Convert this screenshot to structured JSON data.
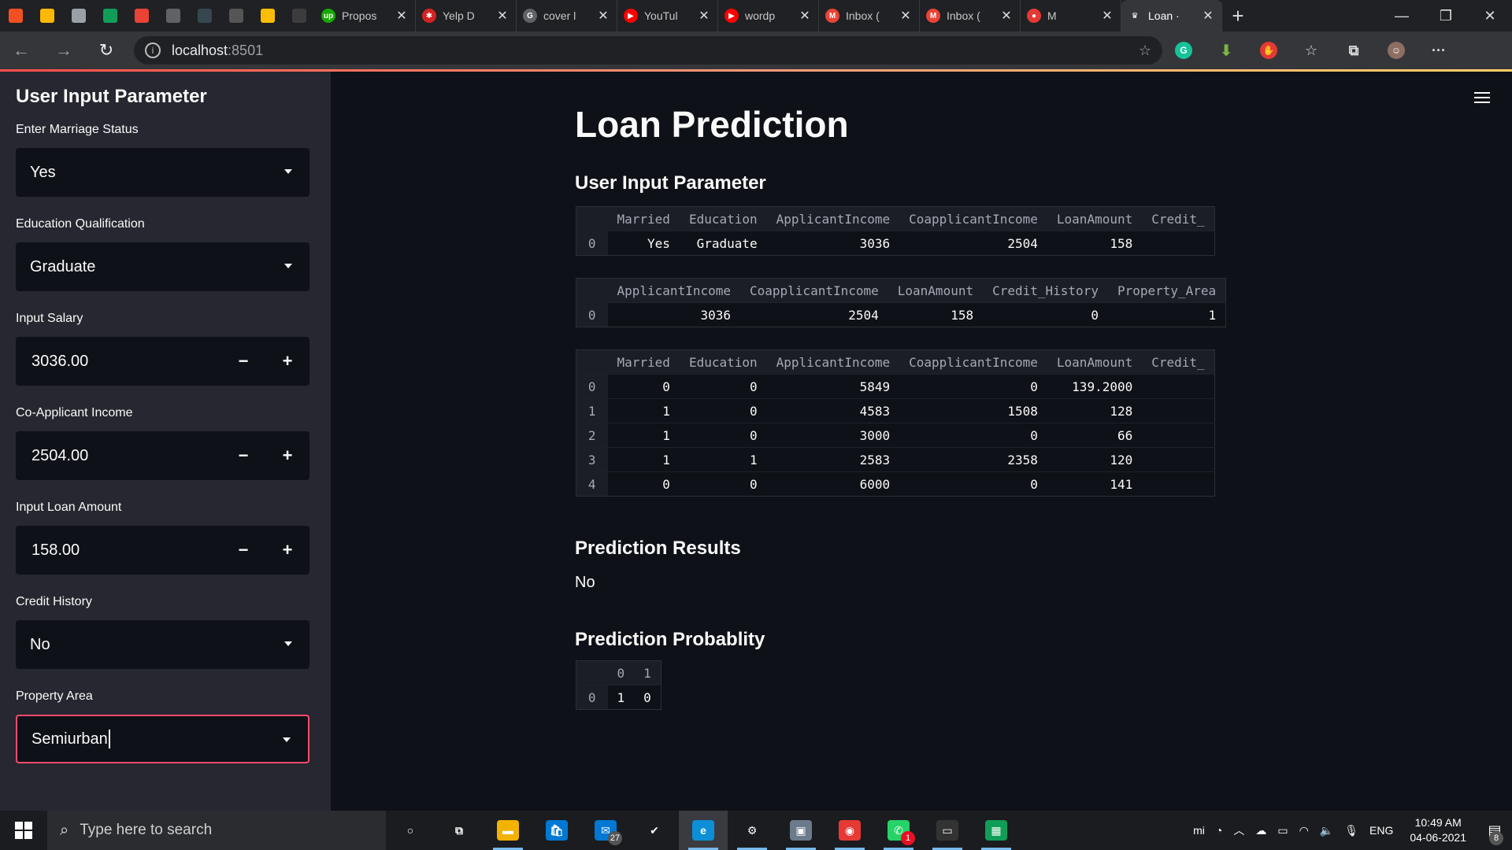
{
  "browser": {
    "pinned_tabs": [
      {
        "icon": "windows-apps-icon",
        "color": "#f25022"
      },
      {
        "icon": "office-grid-icon",
        "color": "#ffb900"
      },
      {
        "icon": "document-icon",
        "color": "#9aa0a6"
      },
      {
        "icon": "sheets-icon",
        "color": "#0f9d58"
      },
      {
        "icon": "gmail-icon",
        "color": "#ea4335"
      },
      {
        "icon": "cc-icon",
        "color": "#5f6368"
      },
      {
        "icon": "tds-icon",
        "color": "#37474f"
      },
      {
        "icon": "w3-icon",
        "color": "#555555"
      },
      {
        "icon": "drive-icon",
        "color": "#fbbc04"
      },
      {
        "icon": "d-icon",
        "color": "#3c3c3c"
      }
    ],
    "tabs": [
      {
        "label": "Propos",
        "fav_color": "#14a800",
        "fav_text": "up"
      },
      {
        "label": "Yelp D",
        "fav_color": "#d32323",
        "fav_text": "✱"
      },
      {
        "label": "cover l",
        "fav_color": "#5f6368",
        "fav_text": "G"
      },
      {
        "label": "YouTul",
        "fav_color": "#ff0000",
        "fav_text": "▶"
      },
      {
        "label": "wordp",
        "fav_color": "#ff0000",
        "fav_text": "▶"
      },
      {
        "label": "Inbox (",
        "fav_color": "#ea4335",
        "fav_text": "M"
      },
      {
        "label": "Inbox (",
        "fav_color": "#ea4335",
        "fav_text": "M"
      },
      {
        "label": "M",
        "fav_color": "#e53935",
        "fav_text": "●"
      },
      {
        "label": "Loan ·",
        "fav_color": "#35363a",
        "fav_text": "♛"
      }
    ],
    "url_host": "localhost",
    "url_port": ":8501"
  },
  "sidebar": {
    "title": "User Input Parameter",
    "marriage": {
      "label": "Enter Marriage Status",
      "value": "Yes"
    },
    "education": {
      "label": "Education Qualification",
      "value": "Graduate"
    },
    "salary": {
      "label": "Input Salary",
      "value": "3036.00"
    },
    "coapplicant": {
      "label": "Co-Applicant Income",
      "value": "2504.00"
    },
    "loan": {
      "label": "Input Loan Amount",
      "value": "158.00"
    },
    "credit": {
      "label": "Credit History",
      "value": "No"
    },
    "property": {
      "label": "Property Area",
      "value": "Semiurban"
    },
    "minus": "−",
    "plus": "+"
  },
  "main": {
    "title": "Loan Prediction",
    "input_header": "User Input Parameter",
    "table1": {
      "columns": [
        "Married",
        "Education",
        "ApplicantIncome",
        "CoapplicantIncome",
        "LoanAmount",
        "Credit_"
      ],
      "rows": [
        {
          "idx": "0",
          "cells": [
            "Yes",
            "Graduate",
            "3036",
            "2504",
            "158",
            ""
          ]
        }
      ]
    },
    "table2": {
      "columns": [
        "ApplicantIncome",
        "CoapplicantIncome",
        "LoanAmount",
        "Credit_History",
        "Property_Area"
      ],
      "rows": [
        {
          "idx": "0",
          "cells": [
            "3036",
            "2504",
            "158",
            "0",
            "1"
          ]
        }
      ]
    },
    "table3": {
      "columns": [
        "Married",
        "Education",
        "ApplicantIncome",
        "CoapplicantIncome",
        "LoanAmount",
        "Credit_"
      ],
      "rows": [
        {
          "idx": "0",
          "cells": [
            "0",
            "0",
            "5849",
            "0",
            "139.2000",
            ""
          ]
        },
        {
          "idx": "1",
          "cells": [
            "1",
            "0",
            "4583",
            "1508",
            "128",
            ""
          ]
        },
        {
          "idx": "2",
          "cells": [
            "1",
            "0",
            "3000",
            "0",
            "66",
            ""
          ]
        },
        {
          "idx": "3",
          "cells": [
            "1",
            "1",
            "2583",
            "2358",
            "120",
            ""
          ]
        },
        {
          "idx": "4",
          "cells": [
            "0",
            "0",
            "6000",
            "0",
            "141",
            ""
          ]
        }
      ]
    },
    "results_header": "Prediction Results",
    "result": "No",
    "probability_header": "Prediction Probablity",
    "table4": {
      "columns": [
        "0",
        "1"
      ],
      "rows": [
        {
          "idx": "0",
          "cells": [
            "1",
            "0"
          ]
        }
      ]
    }
  },
  "taskbar": {
    "search_placeholder": "Type here to search",
    "apps": [
      {
        "name": "cortana-icon",
        "glyph": "○",
        "color": "transparent",
        "running": false
      },
      {
        "name": "task-view-icon",
        "glyph": "⧉",
        "color": "transparent",
        "running": false
      },
      {
        "name": "file-explorer-icon",
        "glyph": "▬",
        "color": "#f2b200",
        "running": true
      },
      {
        "name": "store-icon",
        "glyph": "🛍",
        "color": "#0078d4",
        "running": false
      },
      {
        "name": "mail-icon",
        "glyph": "✉",
        "color": "#0078d4",
        "running": false,
        "badge": "27"
      },
      {
        "name": "todo-icon",
        "glyph": "✔",
        "color": "transparent",
        "running": false
      },
      {
        "name": "edge-icon",
        "glyph": "e",
        "color": "#0c8fd6",
        "running": true,
        "active": true
      },
      {
        "name": "settings-icon",
        "glyph": "⚙",
        "color": "transparent",
        "running": true
      },
      {
        "name": "photos-icon",
        "glyph": "▣",
        "color": "#6b7b8c",
        "running": true
      },
      {
        "name": "camera-app-icon",
        "glyph": "◉",
        "color": "#e53935",
        "running": true
      },
      {
        "name": "whatsapp-icon",
        "glyph": "✆",
        "color": "#25d366",
        "running": true,
        "badge": "1",
        "badge_red": true
      },
      {
        "name": "terminal-icon",
        "glyph": "▭",
        "color": "#333333",
        "running": true
      },
      {
        "name": "sheets-icon",
        "glyph": "▦",
        "color": "#0f9d58",
        "running": true
      }
    ],
    "tray_lang": "ENG",
    "time": "10:49 AM",
    "date": "04-06-2021",
    "notifications": "8"
  }
}
